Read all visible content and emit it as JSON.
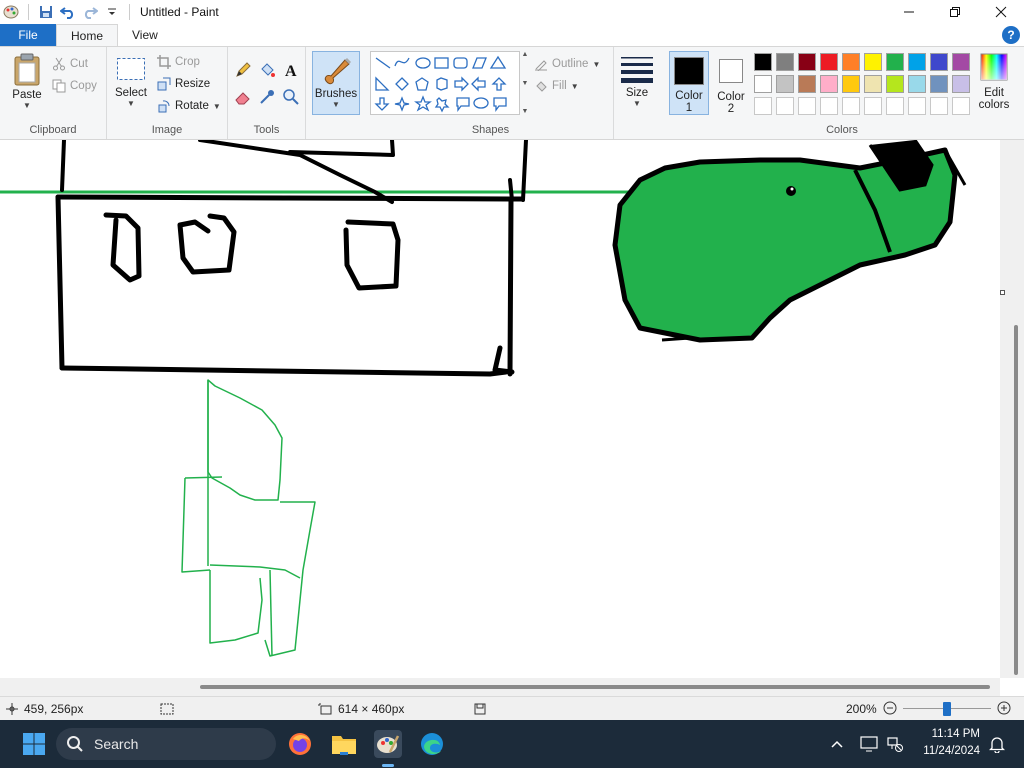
{
  "window": {
    "title": "Untitled - Paint"
  },
  "tabs": {
    "file": "File",
    "home": "Home",
    "view": "View"
  },
  "clipboard": {
    "label": "Clipboard",
    "paste": "Paste",
    "cut": "Cut",
    "copy": "Copy"
  },
  "image": {
    "label": "Image",
    "select": "Select",
    "crop": "Crop",
    "resize": "Resize",
    "rotate": "Rotate"
  },
  "tools": {
    "label": "Tools"
  },
  "brushes": {
    "label": "Brushes"
  },
  "shapes": {
    "label": "Shapes",
    "outline": "Outline",
    "fill": "Fill"
  },
  "size": {
    "label": "Size"
  },
  "colors": {
    "label": "Colors",
    "color1_label": "Color",
    "color1_num": "1",
    "color2_label": "Color",
    "color2_num": "2",
    "edit_label_1": "Edit",
    "edit_label_2": "colors",
    "color1_value": "#000000",
    "color2_value": "#ffffff",
    "palette_row1": [
      "#000000",
      "#7f7f7f",
      "#880015",
      "#ed1c24",
      "#ff7f27",
      "#fff200",
      "#22b14c",
      "#00a2e8",
      "#3f48cc",
      "#a349a4"
    ],
    "palette_row2": [
      "#ffffff",
      "#c3c3c3",
      "#b97a57",
      "#ffaec9",
      "#ffc90e",
      "#efe4b0",
      "#b5e61d",
      "#99d9ea",
      "#7092be",
      "#c8bfe7"
    ]
  },
  "status": {
    "cursor_pos": "459, 256px",
    "canvas_size": "614 × 460px",
    "zoom": "200%",
    "zoom_fraction": 0.5
  },
  "taskbar": {
    "search_placeholder": "Search",
    "time": "11:14 PM",
    "date": "11/24/2024"
  },
  "accent": "#1e6fc6"
}
